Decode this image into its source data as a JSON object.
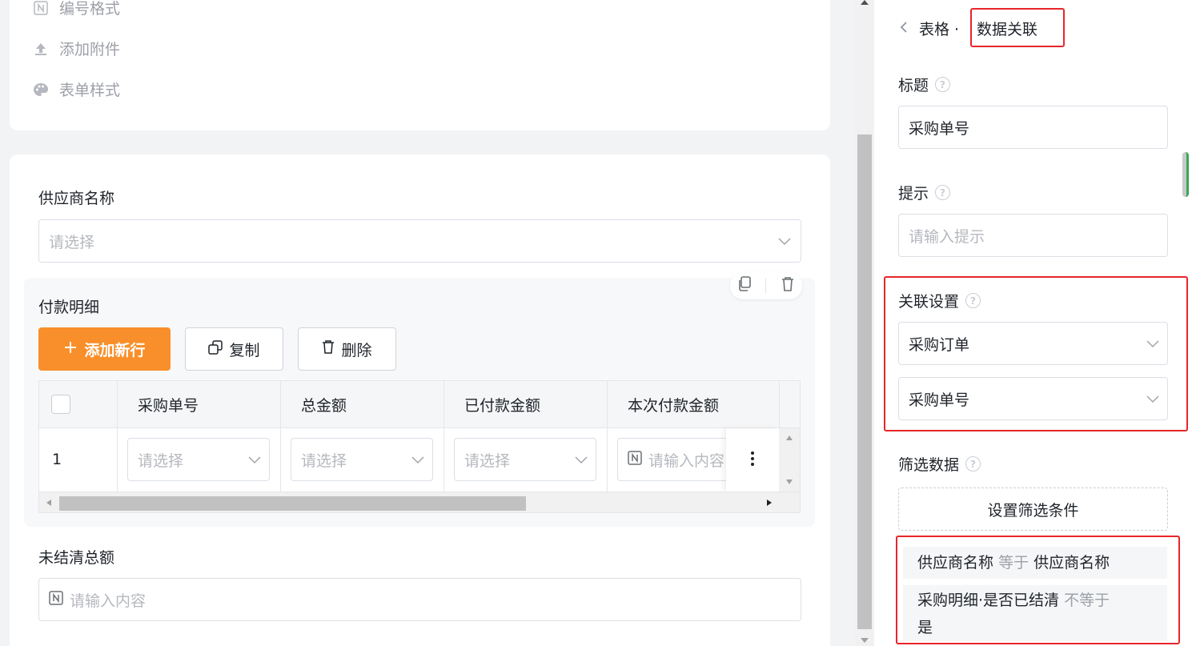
{
  "canvas": {
    "menu": [
      {
        "label": "编号格式",
        "icon": "number-format-icon"
      },
      {
        "label": "添加附件",
        "icon": "upload-icon"
      },
      {
        "label": "表单样式",
        "icon": "palette-icon"
      }
    ],
    "supplier": {
      "label": "供应商名称",
      "placeholder": "请选择"
    },
    "subtable": {
      "title": "付款明细",
      "add_label": "添加新行",
      "copy_label": "复制",
      "delete_label": "删除",
      "columns": [
        "采购单号",
        "总金额",
        "已付款金额",
        "本次付款金额"
      ],
      "row": {
        "index": "1",
        "cells": [
          "请选择",
          "请选择",
          "请选择",
          "请输入内容"
        ]
      }
    },
    "outstanding": {
      "label": "未结清总额",
      "placeholder": "请输入内容"
    }
  },
  "panel": {
    "breadcrumb_parent": "表格 ·",
    "breadcrumb_current": "数据关联",
    "title_label": "标题",
    "title_value": "采购单号",
    "hint_label": "提示",
    "hint_placeholder": "请输入提示",
    "relation_label": "关联设置",
    "relation_form": "采购订单",
    "relation_field": "采购单号",
    "filter_label": "筛选数据",
    "filter_button": "设置筛选条件",
    "conditions": [
      {
        "left": "供应商名称",
        "op": "等于",
        "right": "供应商名称"
      },
      {
        "left": "采购明细·是否已结清",
        "op": "不等于",
        "right": "是"
      }
    ]
  },
  "colors": {
    "accent": "#f98f2a",
    "highlight": "#e8262a"
  }
}
